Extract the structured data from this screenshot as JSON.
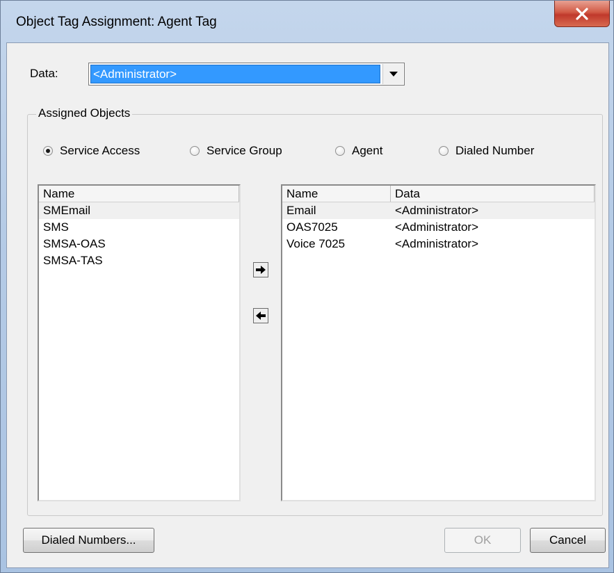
{
  "window": {
    "title": "Object Tag Assignment: Agent Tag",
    "close_icon": "close-x-icon"
  },
  "data_field": {
    "label": "Data:",
    "value": "<Administrator>"
  },
  "assigned_objects": {
    "title": "Assigned Objects",
    "radios": [
      {
        "label": "Service Access",
        "checked": true
      },
      {
        "label": "Service Group",
        "checked": false
      },
      {
        "label": "Agent",
        "checked": false
      },
      {
        "label": "Dialed Number",
        "checked": false
      }
    ],
    "available_list": {
      "columns": [
        "Name"
      ],
      "rows": [
        "SMEmail",
        "SMS",
        "SMSA-OAS",
        "SMSA-TAS"
      ]
    },
    "assigned_list": {
      "columns": [
        "Name",
        "Data"
      ],
      "rows": [
        {
          "name": "Email",
          "data": "<Administrator>"
        },
        {
          "name": "OAS7025",
          "data": "<Administrator>"
        },
        {
          "name": "Voice 7025",
          "data": "<Administrator>"
        }
      ]
    },
    "add_icon": "arrow-right-icon",
    "remove_icon": "arrow-left-icon"
  },
  "buttons": {
    "dialed_numbers": "Dialed Numbers...",
    "ok": "OK",
    "cancel": "Cancel"
  }
}
